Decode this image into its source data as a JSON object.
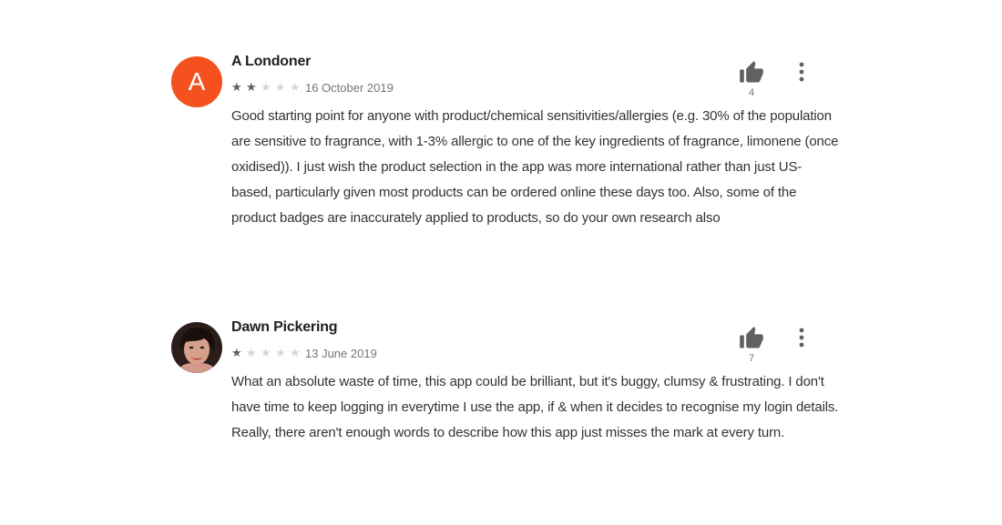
{
  "reviews": [
    {
      "author": "A Londoner",
      "avatar_letter": "A",
      "avatar_color": "#f4511e",
      "rating": 2,
      "max_rating": 5,
      "date": "16 October 2019",
      "helpful_count": "4",
      "body": "Good starting point for anyone with product/chemical sensitivities/allergies (e.g. 30% of the population are sensitive to fragrance, with 1-3% allergic to one of the key ingredients of fragrance, limonene (once oxidised)). I just wish the product selection in the app was more international rather than just US-based, particularly given most products can be ordered online these days too. Also, some of the product badges are inaccurately applied to products, so do your own research also"
    },
    {
      "author": "Dawn Pickering",
      "avatar_type": "photo",
      "rating": 1,
      "max_rating": 5,
      "date": "13 June 2019",
      "helpful_count": "7",
      "body": "What an absolute waste of time, this app could be brilliant, but it's buggy, clumsy & frustrating. I don't have time to keep logging in everytime I use the app, if & when it decides to recognise my login details. Really, there aren't enough words to describe how this app just misses the mark at every turn."
    }
  ],
  "icons": {
    "thumb": "thumb-up-icon",
    "more": "more-vert-icon",
    "star": "star-icon"
  },
  "colors": {
    "star_on": "#616161",
    "star_off": "#d6d6d6",
    "icon": "#616161",
    "date": "#757575"
  }
}
